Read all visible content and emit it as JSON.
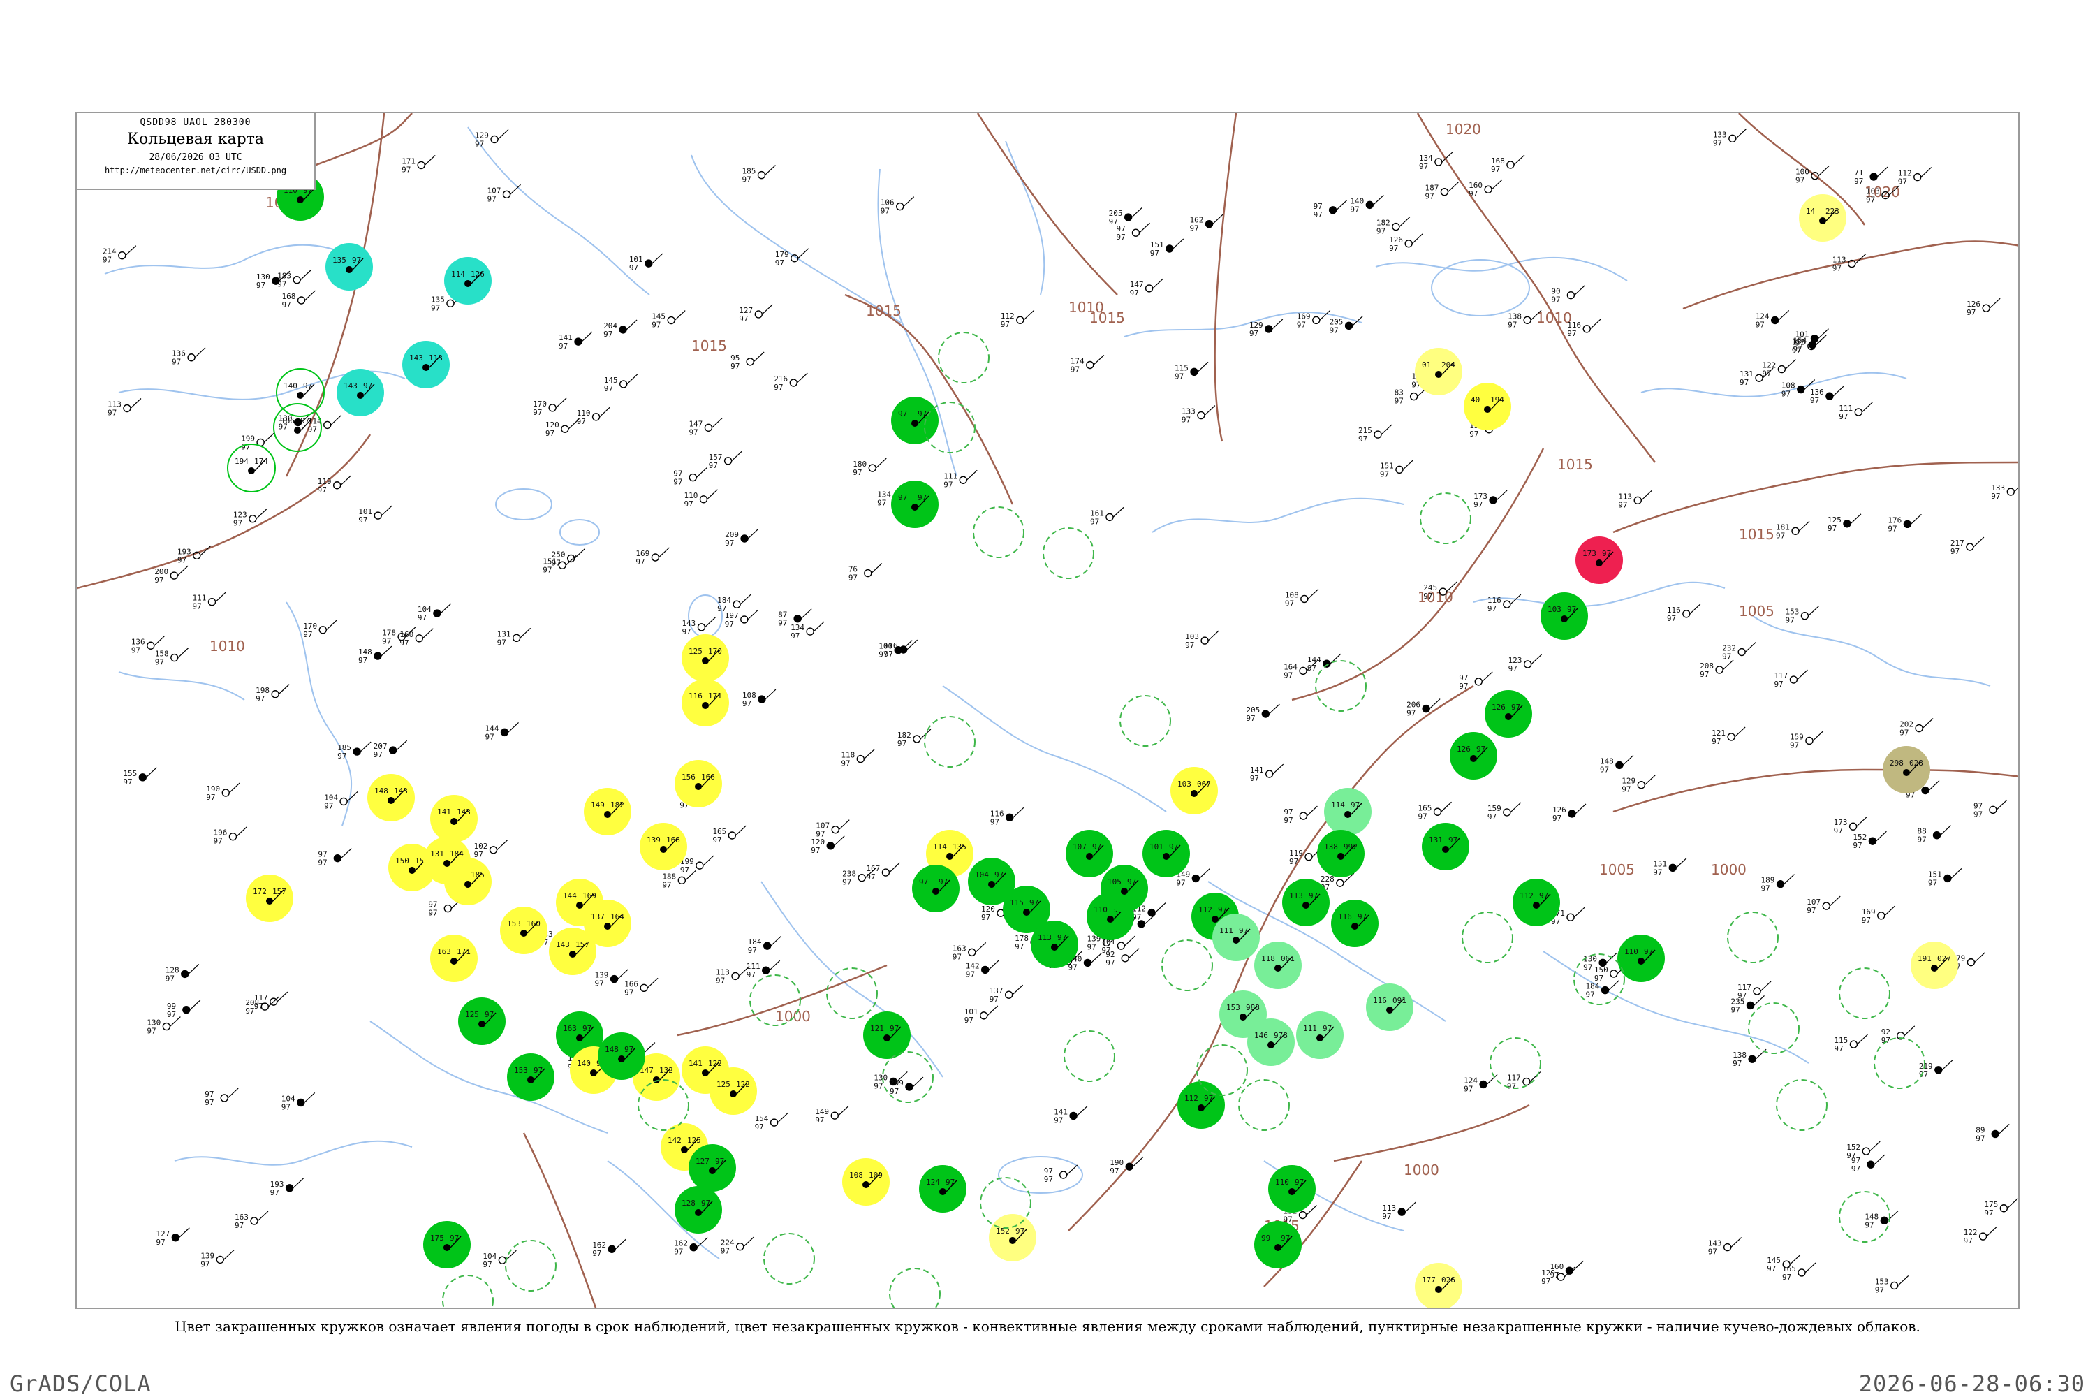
{
  "header": {
    "code_line": "QSDD98 UAOL 280300",
    "title": "Кольцевая карта",
    "date": "28/06/2026 03 UTC",
    "url": "http://meteocenter.net/circ/USDD.png"
  },
  "caption": "Цвет закрашенных кружков означает явления погоды в срок наблюдений, цвет незакрашенных кружков - конвективные явления между сроками наблюдений, пунктирные незакрашенные кружки - наличие кучево-дождевых облаков.",
  "footer": {
    "left": "GrADS/COLA",
    "right": "2026-06-28-06:30"
  },
  "colors": {
    "isobar": "#a0614f",
    "river": "#9fc3ee",
    "rain_green": "#00c418",
    "cb_dashed": "#3fb74a",
    "fog_yellow": "#ffff40",
    "turquoise": "#28e0c8",
    "light_green": "#78ee98",
    "thunder_red": "#ee2050",
    "haze_olive": "#c0b880"
  },
  "isobar_labels": [
    {
      "id": "iso-1010-nw",
      "text": "1010"
    },
    {
      "id": "iso-1010-w",
      "text": "1010"
    },
    {
      "id": "iso-1015-c",
      "text": "1015"
    },
    {
      "id": "iso-1015-n",
      "text": "1015"
    },
    {
      "id": "iso-1010-n",
      "text": "1010"
    },
    {
      "id": "iso-1020-ne",
      "text": "1020"
    },
    {
      "id": "iso-1020-e",
      "text": "1020"
    },
    {
      "id": "iso-1015-e",
      "text": "1015"
    },
    {
      "id": "iso-1015-ne",
      "text": "1015"
    },
    {
      "id": "iso-1010-e",
      "text": "1010"
    },
    {
      "id": "iso-1010-ce",
      "text": "1010"
    },
    {
      "id": "iso-1005-e",
      "text": "1005"
    },
    {
      "id": "iso-1000-ce",
      "text": "1000"
    },
    {
      "id": "iso-1000-c",
      "text": "1000"
    },
    {
      "id": "iso-1000-e",
      "text": "1000"
    },
    {
      "id": "iso-1000-s",
      "text": "1000"
    },
    {
      "id": "iso-1015-sw",
      "text": "1015"
    },
    {
      "id": "iso-1015-w",
      "text": "1015"
    },
    {
      "id": "iso-1005-s",
      "text": "1005"
    }
  ],
  "stations": [
    {
      "t": "110",
      "p": "97",
      "c": "#00c418",
      "type": "filled"
    },
    {
      "t": "135",
      "p": "97",
      "c": "#28e0c8",
      "type": "filled"
    },
    {
      "t": "114",
      "p": "126",
      "c": "#28e0c8",
      "type": "filled"
    },
    {
      "t": "143",
      "p": "113",
      "c": "#28e0c8",
      "type": "filled"
    },
    {
      "t": "143",
      "p": "97",
      "c": "#28e0c8",
      "type": "filled"
    },
    {
      "t": "140",
      "p": "97",
      "c": "#00c418",
      "type": "ring"
    },
    {
      "t": "186",
      "p": "97",
      "c": "#00c418",
      "type": "ring"
    },
    {
      "t": "194",
      "p": "174",
      "c": "#00c418",
      "type": "ring"
    },
    {
      "t": "125",
      "p": "170",
      "c": "#ffff40",
      "type": "filled"
    },
    {
      "t": "116",
      "p": "171",
      "c": "#ffff40",
      "type": "filled"
    },
    {
      "t": "148",
      "p": "143",
      "c": "#ffff40",
      "type": "filled"
    },
    {
      "t": "150",
      "p": "151",
      "c": "#ffff40",
      "type": "filled"
    },
    {
      "t": "188",
      "p": "185",
      "c": "#ffff40",
      "type": "filled"
    },
    {
      "t": "141",
      "p": "143",
      "c": "#ffff40",
      "type": "filled"
    },
    {
      "t": "131",
      "p": "184",
      "c": "#ffff40",
      "type": "filled"
    },
    {
      "t": "172",
      "p": "157",
      "c": "#ffff40",
      "type": "filled"
    },
    {
      "t": "163",
      "p": "171",
      "c": "#ffff40",
      "type": "filled"
    },
    {
      "t": "153",
      "p": "160",
      "c": "#ffff40",
      "type": "filled"
    },
    {
      "t": "144",
      "p": "169",
      "c": "#ffff40",
      "type": "filled"
    },
    {
      "t": "143",
      "p": "157",
      "c": "#ffff40",
      "type": "filled"
    },
    {
      "t": "137",
      "p": "164",
      "c": "#ffff40",
      "type": "filled"
    },
    {
      "t": "139",
      "p": "168",
      "c": "#ffff40",
      "type": "filled"
    },
    {
      "t": "149",
      "p": "182",
      "c": "#ffff40",
      "type": "filled"
    },
    {
      "t": "156",
      "p": "166",
      "c": "#ffff40",
      "type": "filled"
    },
    {
      "t": "163",
      "p": "97",
      "c": "#00c418",
      "type": "filled"
    },
    {
      "t": "153",
      "p": "97",
      "c": "#00c418",
      "type": "filled"
    },
    {
      "t": "140",
      "p": "97",
      "c": "#ffff40",
      "type": "filled"
    },
    {
      "t": "147",
      "p": "132",
      "c": "#ffff40",
      "type": "filled"
    },
    {
      "t": "141",
      "p": "122",
      "c": "#ffff40",
      "type": "filled"
    },
    {
      "t": "125",
      "p": "122",
      "c": "#ffff40",
      "type": "filled"
    },
    {
      "t": "142",
      "p": "125",
      "c": "#ffff40",
      "type": "filled"
    },
    {
      "t": "127",
      "p": "97",
      "c": "#00c418",
      "type": "filled"
    },
    {
      "t": "128",
      "p": "97",
      "c": "#00c418",
      "type": "filled"
    },
    {
      "t": "175",
      "p": "97",
      "c": "#00c418",
      "type": "filled"
    },
    {
      "t": "148",
      "p": "97",
      "c": "#00c418",
      "type": "filled"
    },
    {
      "t": "125",
      "p": "97",
      "c": "#00c418",
      "type": "filled"
    },
    {
      "t": "121",
      "p": "97",
      "c": "#00c418",
      "type": "filled"
    },
    {
      "t": "108",
      "p": "109",
      "c": "#ffff40",
      "type": "filled"
    },
    {
      "t": "124",
      "p": "97",
      "c": "#00c418",
      "type": "filled"
    },
    {
      "t": "114",
      "p": "135",
      "c": "#ffff40",
      "type": "filled"
    },
    {
      "t": "97",
      "p": "97",
      "c": "#00c418",
      "type": "filled"
    },
    {
      "t": "104",
      "p": "97",
      "c": "#00c418",
      "type": "filled"
    },
    {
      "t": "115",
      "p": "97",
      "c": "#00c418",
      "type": "filled"
    },
    {
      "t": "113",
      "p": "97",
      "c": "#00c418",
      "type": "filled"
    },
    {
      "t": "110",
      "p": "97",
      "c": "#00c418",
      "type": "filled"
    },
    {
      "t": "107",
      "p": "97",
      "c": "#00c418",
      "type": "filled"
    },
    {
      "t": "103",
      "p": "067",
      "c": "#ffff40",
      "type": "filled"
    },
    {
      "t": "105",
      "p": "97",
      "c": "#00c418",
      "type": "filled"
    },
    {
      "t": "101",
      "p": "97",
      "c": "#00c418",
      "type": "filled"
    },
    {
      "t": "112",
      "p": "97",
      "c": "#00c418",
      "type": "filled"
    },
    {
      "t": "118",
      "p": "061",
      "c": "#78ee98",
      "type": "filled"
    },
    {
      "t": "111",
      "p": "97",
      "c": "#78ee98",
      "type": "filled"
    },
    {
      "t": "114",
      "p": "97",
      "c": "#78ee98",
      "type": "filled"
    },
    {
      "t": "138",
      "p": "992",
      "c": "#00c418",
      "type": "filled"
    },
    {
      "t": "113",
      "p": "97",
      "c": "#00c418",
      "type": "filled"
    },
    {
      "t": "153",
      "p": "988",
      "c": "#78ee98",
      "type": "filled"
    },
    {
      "t": "146",
      "p": "978",
      "c": "#78ee98",
      "type": "filled"
    },
    {
      "t": "116",
      "p": "091",
      "c": "#78ee98",
      "type": "filled"
    },
    {
      "t": "111",
      "p": "97",
      "c": "#78ee98",
      "type": "filled"
    },
    {
      "t": "116",
      "p": "97",
      "c": "#00c418",
      "type": "filled"
    },
    {
      "t": "131",
      "p": "97",
      "c": "#00c418",
      "type": "filled"
    },
    {
      "t": "126",
      "p": "97",
      "c": "#00c418",
      "type": "filled"
    },
    {
      "t": "126",
      "p": "97",
      "c": "#00c418",
      "type": "filled"
    },
    {
      "t": "112",
      "p": "97",
      "c": "#00c418",
      "type": "filled"
    },
    {
      "t": "110",
      "p": "97",
      "c": "#00c418",
      "type": "filled"
    },
    {
      "t": "112",
      "p": "97",
      "c": "#00c418",
      "type": "filled"
    },
    {
      "t": "110",
      "p": "97",
      "c": "#00c418",
      "type": "filled"
    },
    {
      "t": "99",
      "p": "97",
      "c": "#00c418",
      "type": "filled"
    },
    {
      "t": "173",
      "p": "97",
      "c": "#ee2050",
      "type": "filled"
    },
    {
      "t": "103",
      "p": "97",
      "c": "#00c418",
      "type": "filled"
    },
    {
      "t": "01",
      "p": "204",
      "c": "#ffff80",
      "type": "filled"
    },
    {
      "t": "40",
      "p": "194",
      "c": "#ffff40",
      "type": "filled"
    },
    {
      "t": "14",
      "p": "223",
      "c": "#ffff80",
      "type": "filled"
    },
    {
      "t": "298",
      "p": "028",
      "c": "#c0b880",
      "type": "filled"
    },
    {
      "t": "191",
      "p": "027",
      "c": "#ffff80",
      "type": "filled"
    },
    {
      "t": "177",
      "p": "026",
      "c": "#ffff80",
      "type": "filled"
    },
    {
      "t": "152",
      "p": "97",
      "c": "#ffff80",
      "type": "filled"
    },
    {
      "t": "97",
      "p": "97",
      "c": "#00c418",
      "type": "filled"
    },
    {
      "t": "97",
      "p": "97",
      "c": "#00c418",
      "type": "filled"
    }
  ],
  "plain_obs": [
    "104",
    "112",
    "81",
    "126",
    "115",
    "95",
    "131",
    "126",
    "185",
    "204",
    "131",
    "111",
    "148",
    "199",
    "174",
    "125",
    "122",
    "103",
    "97",
    "179",
    "165",
    "141",
    "133",
    "92",
    "205",
    "107",
    "113",
    "185",
    "190",
    "97",
    "176",
    "164",
    "168",
    "151",
    "178",
    "170",
    "162",
    "159",
    "180",
    "101",
    "167",
    "165",
    "140",
    "155",
    "143",
    "148",
    "169",
    "188",
    "148",
    "160",
    "136",
    "144",
    "182",
    "187",
    "184",
    "169",
    "127",
    "160",
    "197",
    "183",
    "135",
    "158",
    "150",
    "184",
    "171",
    "107",
    "108",
    "117",
    "97",
    "151",
    "159",
    "132",
    "136",
    "171",
    "125",
    "142",
    "133",
    "101",
    "139",
    "163",
    "141",
    "130",
    "145",
    "114",
    "173",
    "161",
    "181",
    "101",
    "175",
    "130",
    "189",
    "182",
    "133",
    "149",
    "113",
    "168",
    "138",
    "153",
    "169",
    "190",
    "137",
    "147",
    "152",
    "139",
    "153",
    "115",
    "166",
    "196",
    "154",
    "178",
    "139",
    "124",
    "129",
    "97",
    "141",
    "157",
    "193",
    "107",
    "138",
    "97",
    "104",
    "126",
    "122",
    "130",
    "149",
    "154",
    "127",
    "150",
    "118",
    "88",
    "108",
    "107",
    "97",
    "113",
    "134",
    "100",
    "123",
    "116",
    "130",
    "145",
    "101",
    "147",
    "121",
    "97",
    "116",
    "136",
    "117",
    "130",
    "97",
    "131",
    "123",
    "133",
    "129",
    "134",
    "101",
    "153",
    "128",
    "116",
    "100",
    "108",
    "90",
    "113",
    "113",
    "123",
    "117",
    "116",
    "129",
    "92",
    "124",
    "120",
    "135",
    "112",
    "145",
    "110",
    "140",
    "160",
    "119",
    "120",
    "134",
    "106",
    "119",
    "104",
    "97",
    "111",
    "152",
    "154",
    "97",
    "111",
    "119",
    "89",
    "112",
    "103",
    "144",
    "136",
    "120",
    "99",
    "151",
    "102",
    "162",
    "151",
    "165",
    "155",
    "116",
    "83",
    "71",
    "76",
    "110",
    "87",
    "97",
    "117",
    "206",
    "215",
    "173",
    "219",
    "228",
    "217",
    "205",
    "208",
    "245",
    "235",
    "232",
    "216",
    "209",
    "199",
    "200",
    "151",
    "198",
    "250",
    "207",
    "170",
    "208",
    "209",
    "214",
    "238",
    "249",
    "184",
    "111",
    "193",
    "147",
    "104",
    "162",
    "143",
    "163",
    "129",
    "179",
    "202",
    "205",
    "224"
  ]
}
